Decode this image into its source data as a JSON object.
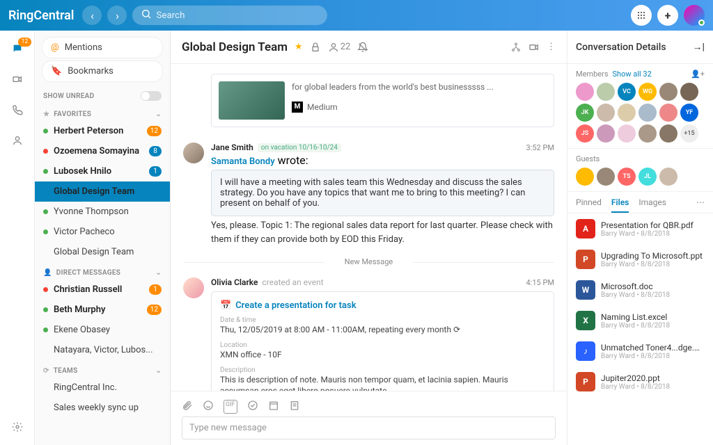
{
  "header": {
    "logo": "RingCentral",
    "search_placeholder": "Search"
  },
  "rail": {
    "badge": "12"
  },
  "sidebar": {
    "mentions": "Mentions",
    "bookmarks": "Bookmarks",
    "show_unread": "SHOW UNREAD",
    "favorites_label": "FAVORITES",
    "favorites": [
      {
        "name": "Herbert Peterson",
        "dot": "#4caf50",
        "badge": "12",
        "badge_cls": "badge"
      },
      {
        "name": "Ozoemena Somayina",
        "dot": "#f44336",
        "badge": "8",
        "badge_cls": "badge blue"
      },
      {
        "name": "Lubosek Hnilo",
        "dot": "#4caf50",
        "badge": "1",
        "badge_cls": "badge blue"
      },
      {
        "name": "Global Design Team",
        "sel": true
      },
      {
        "name": "Yvonne Thompson",
        "dot": "#4caf50"
      },
      {
        "name": "Victor Pacheco",
        "dot": "#4caf50"
      },
      {
        "name": "Global Design Team"
      }
    ],
    "dm_label": "DIRECT MESSAGES",
    "dms": [
      {
        "name": "Christian Russell",
        "dot": "#f44336",
        "badge": "1",
        "badge_cls": "badge"
      },
      {
        "name": "Beth Murphy",
        "dot": "#4caf50",
        "badge": "12",
        "badge_cls": "badge"
      },
      {
        "name": "Ekene Obasey",
        "dot": "#4caf50"
      },
      {
        "name": "Natayara, Victor, Lubos..."
      }
    ],
    "teams_label": "TEAMS",
    "teams": [
      {
        "name": "RingCentral Inc."
      },
      {
        "name": "Sales weekly sync up"
      }
    ]
  },
  "chat": {
    "title": "Global Design Team",
    "member_count": "22",
    "link_card": {
      "text": "for global leaders from the world's best businesssss ...",
      "source": "Medium"
    },
    "msg1": {
      "name": "Jane Smith",
      "status": "on vacation 10/16-10/24",
      "time": "3:52 PM",
      "reply_to": "Samanta Bondy",
      "wrote": " wrote:",
      "quote": "I will have a meeting with sales team this Wednesday and discuss the sales strategy.  Do you have any topics that want me to bring to this meeting? I can present on behalf of you.",
      "body": "Yes, please.  Topic 1: The regional sales data report for last quarter.  Please check with them if they can provide both by EOD this Friday."
    },
    "divider": "New Message",
    "msg2": {
      "name": "Olivia Clarke",
      "action": "created an event",
      "time": "4:15 PM",
      "event_title": "Create a presentation for task",
      "dt_label": "Date & time",
      "dt": "Thu, 12/05/2019 at 8:00 AM - 11:00AM, repeating every month",
      "loc_label": "Location",
      "loc": "XMN office - 10F",
      "desc_label": "Description",
      "desc": "This is description of note. Mauris non tempor quam, et lacinia sapien. Mauris accumsan eros eget libero posuere vulputate."
    },
    "compose_placeholder": "Type new message"
  },
  "details": {
    "title": "Conversation Details",
    "members_label": "Members",
    "show_all": "Show all 32",
    "guests_label": "Guests",
    "member_avatars": [
      "",
      "",
      "VC",
      "WG",
      "",
      "",
      "JK",
      "",
      "",
      "",
      "",
      "YF",
      "JS",
      "",
      "",
      "",
      "",
      "+15"
    ],
    "tabs": [
      "Pinned",
      "Files",
      "Images"
    ],
    "files": [
      {
        "name": "Presentation for QBR.pdf",
        "meta": "Barry Ward  •  8/8/2018",
        "ico": "A",
        "bg": "#e2231a"
      },
      {
        "name": "Upgrading To Microsoft.ppt",
        "meta": "Barry Ward  •  8/8/2018",
        "ico": "P",
        "bg": "#d24726"
      },
      {
        "name": "Microsoft.doc",
        "meta": "Barry Ward  •  8/8/2018",
        "ico": "W",
        "bg": "#2b579a"
      },
      {
        "name": "Naming List.excel",
        "meta": "Barry Ward  •  8/8/2018",
        "ico": "X",
        "bg": "#217346"
      },
      {
        "name": "Unmatched Toner4...dge.mp4",
        "meta": "Barry Ward  •  8/8/2018",
        "ico": "♪",
        "bg": "#2962ff"
      },
      {
        "name": "Jupiter2020.ppt",
        "meta": "Barry Ward  •  8/8/2018",
        "ico": "P",
        "bg": "#d24726"
      }
    ]
  }
}
